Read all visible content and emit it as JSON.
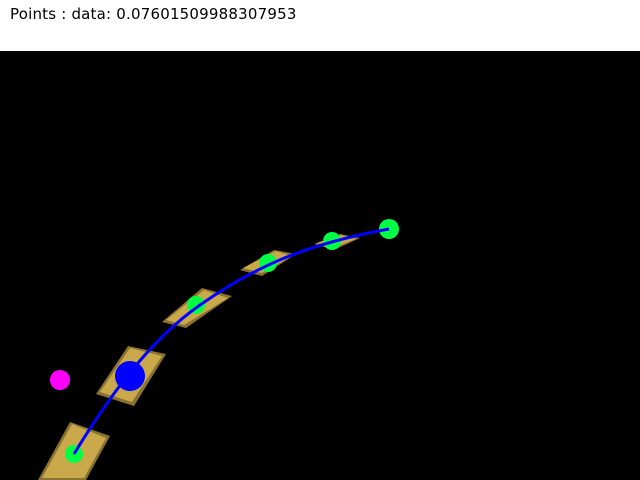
{
  "header": {
    "text": "Points : data: 0.07601509988307953"
  },
  "scene": {
    "background_color": "#000000",
    "segment_color": "#C9A94A",
    "segment_shadow_color": "#8A7230",
    "curve_color": "#0000FF",
    "control_point_color": "#00FF44",
    "handle_color": "#0000FF",
    "target_point_color": "#FF00FF",
    "segment_count": 6,
    "control_point_count": 5
  }
}
